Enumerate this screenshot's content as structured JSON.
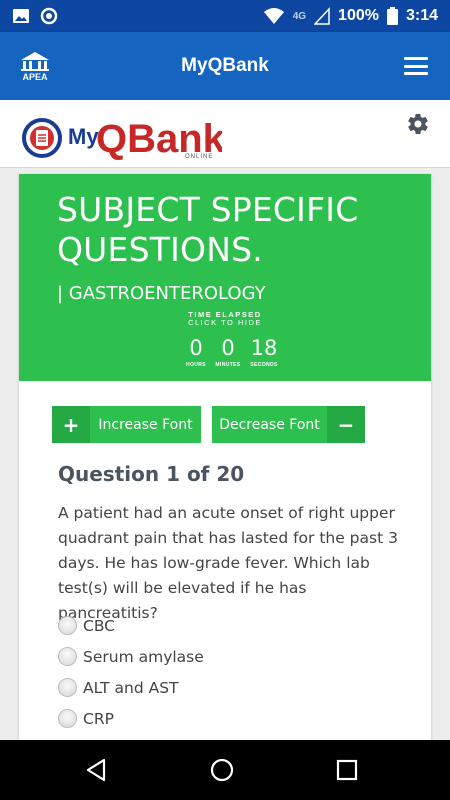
{
  "status_bar": {
    "battery_percent": "100%",
    "time": "3:14",
    "network": "4G",
    "icons": [
      "image-icon",
      "sync-icon",
      "wifi-icon",
      "signal-icon",
      "battery-icon"
    ]
  },
  "app_bar": {
    "title": "MyQBank",
    "logo_text": "APEA",
    "menu_icon": "hamburger-menu-icon"
  },
  "brand": {
    "logo_prefix": "My",
    "logo_name": "QBank",
    "logo_tagline": "ONLINE",
    "settings_icon": "gear-icon"
  },
  "banner": {
    "heading_line1": "SUBJECT SPECIFIC",
    "heading_line2": "QUESTIONS.",
    "subject": "| GASTROENTEROLOGY",
    "timer_label": "TIME ELAPSED",
    "timer_hint": "CLICK TO HIDE",
    "hours": "0",
    "minutes": "0",
    "seconds": "18",
    "hours_label": "HOURS",
    "minutes_label": "MINUTES",
    "seconds_label": "SECONDS",
    "color": "#2ec04f"
  },
  "controls": {
    "increase_font": "Increase Font",
    "decrease_font": "Decrease Font",
    "increase_icon": "+",
    "decrease_icon": "−"
  },
  "question": {
    "title": "Question 1 of 20",
    "text": "A patient had an acute onset of right upper quadrant pain that has lasted for the past 3 days. He has low-grade fever. Which lab test(s) will be elevated if he has pancreatitis?",
    "options": [
      "CBC",
      "Serum amylase",
      "ALT and AST",
      "CRP"
    ]
  },
  "nav_bar": {
    "icons": [
      "back-icon",
      "home-icon",
      "recents-icon"
    ]
  }
}
